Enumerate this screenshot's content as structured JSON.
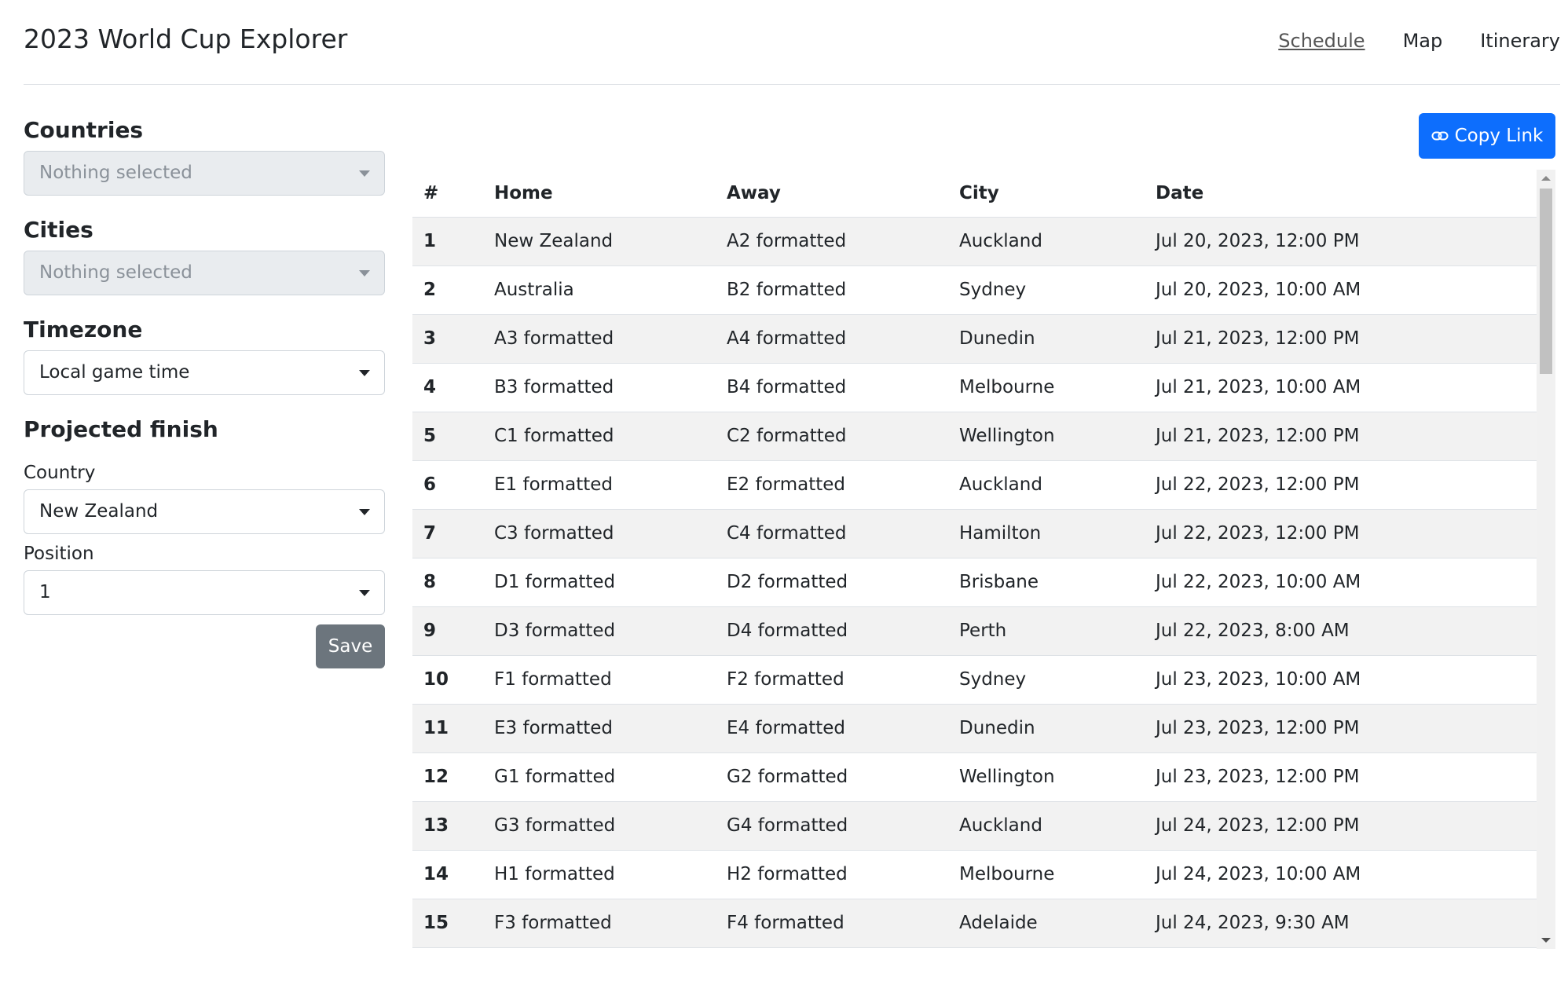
{
  "header": {
    "title": "2023 World Cup Explorer",
    "nav": [
      "Schedule",
      "Map",
      "Itinerary"
    ]
  },
  "sidebar": {
    "countries": {
      "title": "Countries",
      "value": "Nothing selected"
    },
    "cities": {
      "title": "Cities",
      "value": "Nothing selected"
    },
    "timezone": {
      "title": "Timezone",
      "value": "Local game time"
    },
    "projected": {
      "title": "Projected finish",
      "country_label": "Country",
      "country_value": "New Zealand",
      "position_label": "Position",
      "position_value": "1",
      "save_label": "Save"
    }
  },
  "toolbar": {
    "copy_label": "Copy Link",
    "copy_icon": "link-icon"
  },
  "table": {
    "headers": [
      "#",
      "Home",
      "Away",
      "City",
      "Date"
    ],
    "rows": [
      [
        "1",
        "New Zealand",
        "A2 formatted",
        "Auckland",
        "Jul 20, 2023, 12:00 PM"
      ],
      [
        "2",
        "Australia",
        "B2 formatted",
        "Sydney",
        "Jul 20, 2023, 10:00 AM"
      ],
      [
        "3",
        "A3 formatted",
        "A4 formatted",
        "Dunedin",
        "Jul 21, 2023, 12:00 PM"
      ],
      [
        "4",
        "B3 formatted",
        "B4 formatted",
        "Melbourne",
        "Jul 21, 2023, 10:00 AM"
      ],
      [
        "5",
        "C1 formatted",
        "C2 formatted",
        "Wellington",
        "Jul 21, 2023, 12:00 PM"
      ],
      [
        "6",
        "E1 formatted",
        "E2 formatted",
        "Auckland",
        "Jul 22, 2023, 12:00 PM"
      ],
      [
        "7",
        "C3 formatted",
        "C4 formatted",
        "Hamilton",
        "Jul 22, 2023, 12:00 PM"
      ],
      [
        "8",
        "D1 formatted",
        "D2 formatted",
        "Brisbane",
        "Jul 22, 2023, 10:00 AM"
      ],
      [
        "9",
        "D3 formatted",
        "D4 formatted",
        "Perth",
        "Jul 22, 2023, 8:00 AM"
      ],
      [
        "10",
        "F1 formatted",
        "F2 formatted",
        "Sydney",
        "Jul 23, 2023, 10:00 AM"
      ],
      [
        "11",
        "E3 formatted",
        "E4 formatted",
        "Dunedin",
        "Jul 23, 2023, 12:00 PM"
      ],
      [
        "12",
        "G1 formatted",
        "G2 formatted",
        "Wellington",
        "Jul 23, 2023, 12:00 PM"
      ],
      [
        "13",
        "G3 formatted",
        "G4 formatted",
        "Auckland",
        "Jul 24, 2023, 12:00 PM"
      ],
      [
        "14",
        "H1 formatted",
        "H2 formatted",
        "Melbourne",
        "Jul 24, 2023, 10:00 AM"
      ],
      [
        "15",
        "F3 formatted",
        "F4 formatted",
        "Adelaide",
        "Jul 24, 2023, 9:30 AM"
      ]
    ]
  },
  "colors": {
    "primary": "#0d6efd",
    "secondary": "#6c757d",
    "stripe": "#f2f2f2",
    "border": "#dee2e6"
  }
}
